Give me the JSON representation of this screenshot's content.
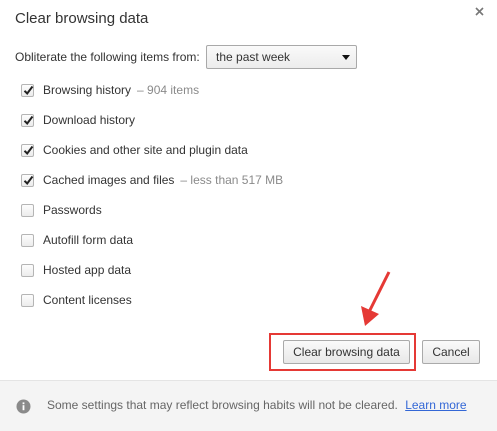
{
  "dialog": {
    "title": "Clear browsing data",
    "close_icon": "close-icon"
  },
  "obliterate": {
    "label": "Obliterate the following items from:",
    "selected": "the past week"
  },
  "options": [
    {
      "label": "Browsing history",
      "detail": "–  904 items",
      "checked": true
    },
    {
      "label": "Download history",
      "detail": "",
      "checked": true
    },
    {
      "label": "Cookies and other site and plugin data",
      "detail": "",
      "checked": true
    },
    {
      "label": "Cached images and files",
      "detail": "–  less than 517 MB",
      "checked": true
    },
    {
      "label": "Passwords",
      "detail": "",
      "checked": false
    },
    {
      "label": "Autofill form data",
      "detail": "",
      "checked": false
    },
    {
      "label": "Hosted app data",
      "detail": "",
      "checked": false
    },
    {
      "label": "Content licenses",
      "detail": "",
      "checked": false
    }
  ],
  "buttons": {
    "clear": "Clear browsing data",
    "cancel": "Cancel"
  },
  "footer": {
    "text": "Some settings that may reflect browsing habits will not be cleared.",
    "link": "Learn more",
    "icon": "info-icon"
  },
  "colors": {
    "highlight": "#e53935",
    "link": "#3367d6"
  }
}
